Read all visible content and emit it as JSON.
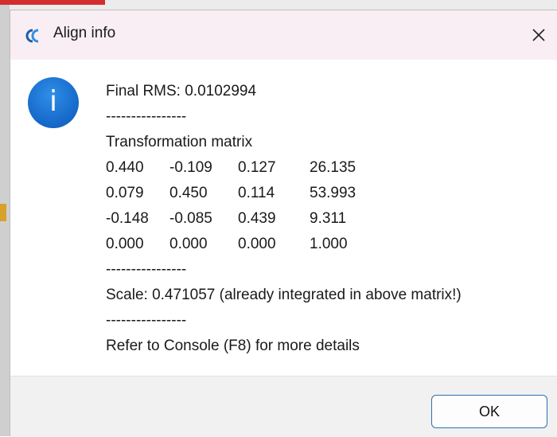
{
  "window": {
    "title": "Align info",
    "app_icon": "cloudcompare-icon",
    "close_icon": "close-icon"
  },
  "message": {
    "rms": "Final RMS: 0.0102994",
    "sep1": "----------------",
    "matrix_label": "Transformation matrix",
    "matrix": [
      [
        "0.440",
        "-0.109",
        "0.127",
        "26.135"
      ],
      [
        "0.079",
        "0.450",
        "0.114",
        "53.993"
      ],
      [
        "-0.148",
        "-0.085",
        "0.439",
        "9.311"
      ],
      [
        "0.000",
        "0.000",
        "0.000",
        "1.000"
      ]
    ],
    "sep2": "----------------",
    "scale": "Scale: 0.471057 (already integrated in above matrix!)",
    "sep3": "----------------",
    "console": "Refer to Console (F8) for more details"
  },
  "buttons": {
    "ok": "OK"
  },
  "colors": {
    "accent": "#1567c8",
    "button_border": "#2f6fb0",
    "titlebar": "#f9eef3"
  }
}
